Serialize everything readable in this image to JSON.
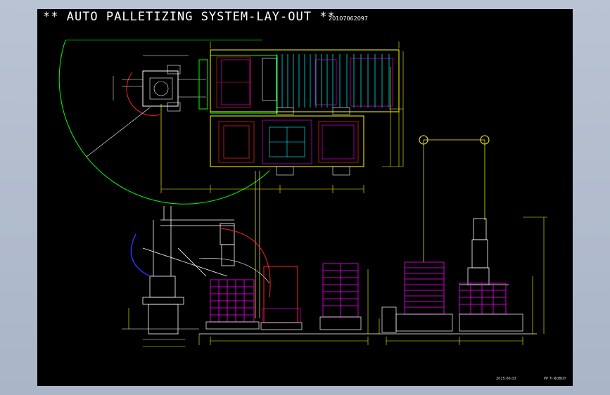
{
  "drawing": {
    "title": "** AUTO PALLETIZING SYSTEM-LAY-OUT **",
    "drawing_code": "20107062097",
    "footer_date": "2015.06.03",
    "footer_label": "PP 7I ROBOT"
  },
  "colors": {
    "background": "#000000",
    "frame": "#aab5c8",
    "yellow": "#ffff00",
    "green": "#00ff00",
    "cyan": "#00ffff",
    "magenta": "#ff00ff",
    "red": "#ff0000",
    "white": "#ffffff",
    "blue": "#3030ff"
  }
}
